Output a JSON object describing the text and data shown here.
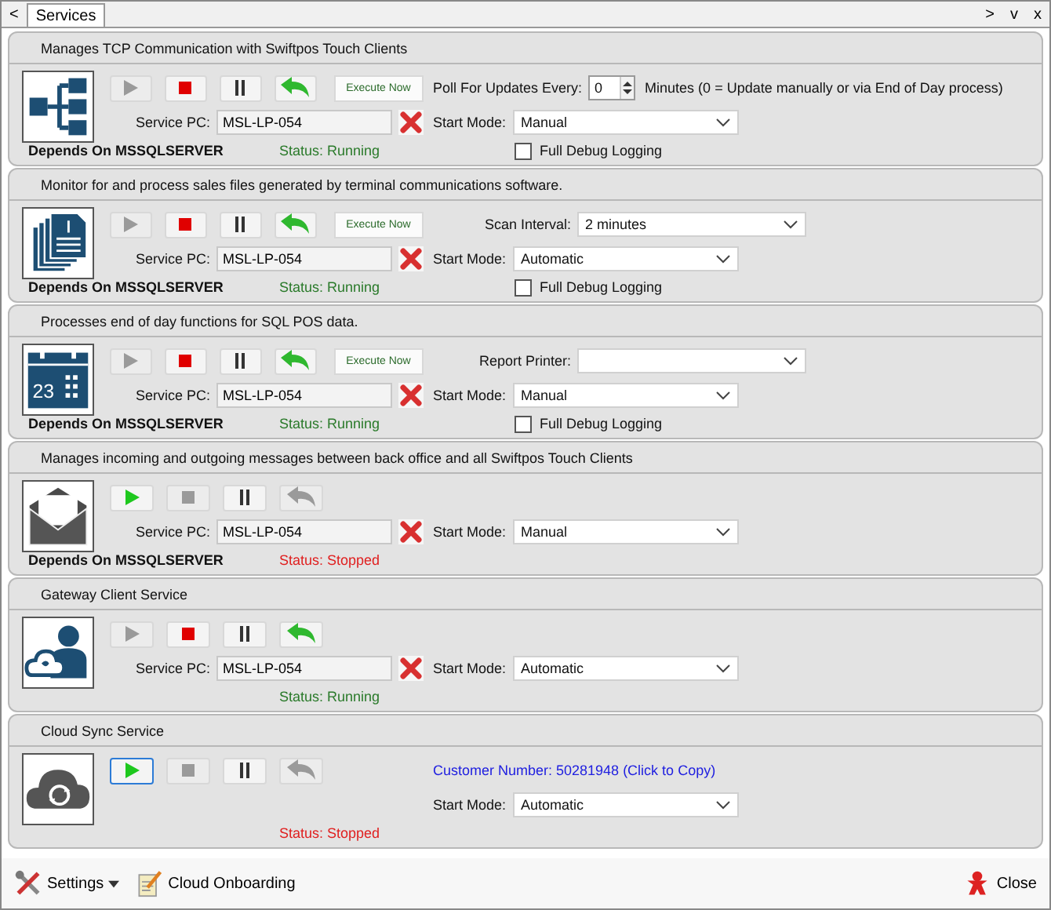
{
  "tabbar": {
    "back": "<",
    "tab": {
      "label": "Services",
      "selected": true
    },
    "controls": [
      ">",
      "v",
      "x"
    ]
  },
  "services": [
    {
      "description": "Manages TCP Communication with Swiftpos Touch Clients",
      "kind": "network",
      "controls": [
        {
          "kind": "play",
          "enabled": false,
          "focused": false
        },
        {
          "kind": "stop",
          "enabled": true,
          "focused": false
        },
        {
          "kind": "pause",
          "enabled": true,
          "focused": false
        },
        {
          "kind": "restart",
          "enabled": true,
          "focused": false
        }
      ],
      "execute": "Execute Now",
      "service_pc": {
        "label": "Service PC:",
        "value": "MSL-LP-054"
      },
      "depends": "Depends On MSSQLSERVER",
      "status": {
        "text": "Status: Running",
        "running": true
      },
      "option": {
        "kind": "spinner",
        "label": "Poll For Updates Every:",
        "value": "0",
        "note": "Minutes (0 = Update manually or via End of Day process)"
      },
      "start_mode": {
        "label": "Start Mode:",
        "value": "Manual"
      },
      "debug": {
        "label": "Full Debug Logging",
        "checked": false
      }
    },
    {
      "description": "Monitor for and process sales files generated by terminal communications software.",
      "kind": "documents",
      "controls": [
        {
          "kind": "play",
          "enabled": false,
          "focused": false
        },
        {
          "kind": "stop",
          "enabled": true,
          "focused": false
        },
        {
          "kind": "pause",
          "enabled": true,
          "focused": false
        },
        {
          "kind": "restart",
          "enabled": true,
          "focused": false
        }
      ],
      "execute": "Execute Now",
      "service_pc": {
        "label": "Service PC:",
        "value": "MSL-LP-054"
      },
      "depends": "Depends On MSSQLSERVER",
      "status": {
        "text": "Status: Running",
        "running": true
      },
      "option": {
        "kind": "dropdown",
        "label": "Scan Interval:",
        "value": "2 minutes"
      },
      "start_mode": {
        "label": "Start Mode:",
        "value": "Automatic"
      },
      "debug": {
        "label": "Full Debug Logging",
        "checked": false
      }
    },
    {
      "description": "Processes end of day functions for SQL POS data.",
      "kind": "calendar",
      "icon_text": "23",
      "controls": [
        {
          "kind": "play",
          "enabled": false,
          "focused": false
        },
        {
          "kind": "stop",
          "enabled": true,
          "focused": false
        },
        {
          "kind": "pause",
          "enabled": true,
          "focused": false
        },
        {
          "kind": "restart",
          "enabled": true,
          "focused": false
        }
      ],
      "execute": "Execute Now",
      "service_pc": {
        "label": "Service PC:",
        "value": "MSL-LP-054"
      },
      "depends": "Depends On MSSQLSERVER",
      "status": {
        "text": "Status: Running",
        "running": true
      },
      "option": {
        "kind": "dropdown",
        "label": "Report Printer:"
      },
      "start_mode": {
        "label": "Start Mode:",
        "value": "Manual"
      },
      "debug": {
        "label": "Full Debug Logging",
        "checked": false
      }
    },
    {
      "description": "Manages incoming and outgoing messages between back office and all Swiftpos Touch Clients",
      "kind": "mail",
      "controls": [
        {
          "kind": "play",
          "enabled": true,
          "focused": false
        },
        {
          "kind": "stop",
          "enabled": false,
          "focused": false
        },
        {
          "kind": "pause",
          "enabled": true,
          "focused": false
        },
        {
          "kind": "restart",
          "enabled": false,
          "focused": false
        }
      ],
      "service_pc": {
        "label": "Service PC:",
        "value": "MSL-LP-054"
      },
      "depends": "Depends On MSSQLSERVER",
      "status": {
        "text": "Status: Stopped",
        "running": false
      },
      "start_mode": {
        "label": "Start Mode:",
        "value": "Manual"
      }
    },
    {
      "description": "Gateway Client Service",
      "kind": "user-cloud",
      "controls": [
        {
          "kind": "play",
          "enabled": false,
          "focused": false
        },
        {
          "kind": "stop",
          "enabled": true,
          "focused": false
        },
        {
          "kind": "pause",
          "enabled": true,
          "focused": false
        },
        {
          "kind": "restart",
          "enabled": true,
          "focused": false
        }
      ],
      "service_pc": {
        "label": "Service PC:",
        "value": "MSL-LP-054"
      },
      "status": {
        "text": "Status: Running",
        "running": true
      },
      "start_mode": {
        "label": "Start Mode:",
        "value": "Automatic"
      }
    },
    {
      "description": "Cloud Sync Service",
      "kind": "cloud-sync",
      "controls": [
        {
          "kind": "play",
          "enabled": true,
          "focused": true
        },
        {
          "kind": "stop",
          "enabled": false,
          "focused": false
        },
        {
          "kind": "pause",
          "enabled": true,
          "focused": false
        },
        {
          "kind": "restart",
          "enabled": false,
          "focused": false
        }
      ],
      "status": {
        "text": "Status: Stopped",
        "running": false
      },
      "option": {
        "kind": "link",
        "label": "Customer Number: 50281948 (Click to Copy)"
      },
      "start_mode": {
        "label": "Start Mode:",
        "value": "Automatic"
      }
    }
  ],
  "footer": {
    "settings": "Settings",
    "onboarding": "Cloud Onboarding",
    "close": "Close"
  }
}
